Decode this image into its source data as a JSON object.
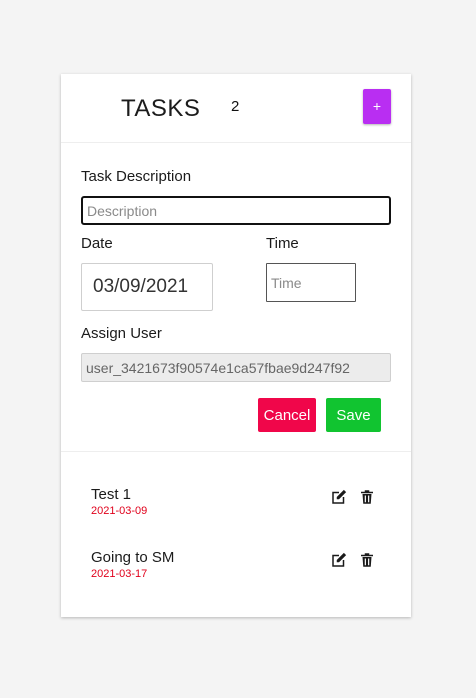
{
  "header": {
    "title": "TASKS",
    "count": "2",
    "add_label": "+"
  },
  "form": {
    "description_label": "Task Description",
    "description_placeholder": "Description",
    "description_value": "",
    "date_label": "Date",
    "date_value": "03/09/2021",
    "time_label": "Time",
    "time_placeholder": "Time",
    "user_label": "Assign User",
    "user_value": "user_3421673f90574e1ca57fbae9d247f92",
    "cancel_label": "Cancel",
    "save_label": "Save"
  },
  "tasks": [
    {
      "name": "Test 1",
      "date": "2021-03-09"
    },
    {
      "name": "Going to SM",
      "date": "2021-03-17"
    }
  ],
  "colors": {
    "add_button": "#b92ef2",
    "cancel_button": "#f0064a",
    "save_button": "#11c430",
    "task_date": "#e0001b"
  },
  "icons": {
    "edit": "edit-icon",
    "delete": "trash-icon"
  }
}
